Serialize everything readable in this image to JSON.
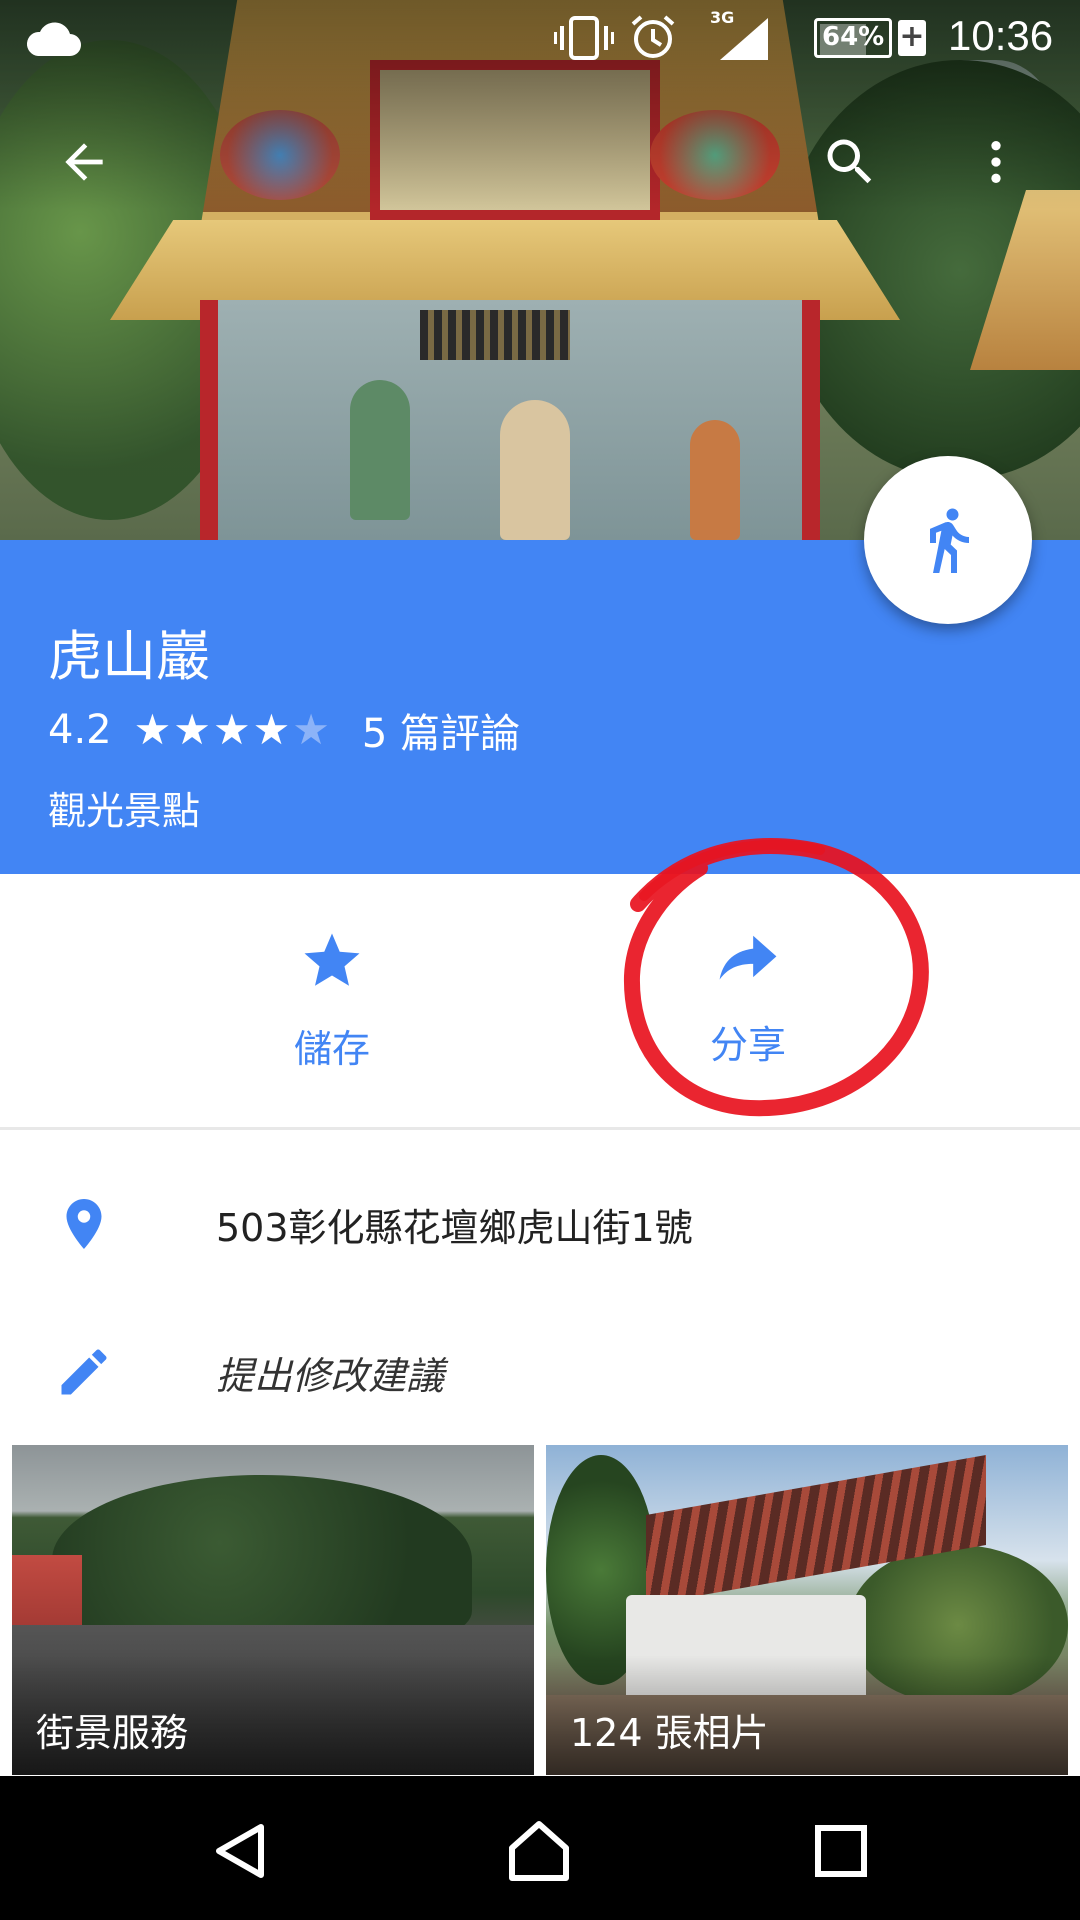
{
  "status_bar": {
    "network_type": "3G",
    "battery_percent": "64%",
    "battery_level": 0.64,
    "time": "10:36",
    "icons": [
      "cloud-icon",
      "vibrate-icon",
      "alarm-icon",
      "signal-icon",
      "battery-charging-icon"
    ]
  },
  "app_bar": {
    "icons": [
      "back-arrow-icon",
      "search-icon",
      "more-vert-icon"
    ]
  },
  "place": {
    "title": "虎山巖",
    "rating": "4.2",
    "rating_value": 4.2,
    "stars_filled": 4,
    "stars_total": 5,
    "reviews": "5 篇評論",
    "category": "觀光景點",
    "header_color": "#4285f4"
  },
  "fab": {
    "icon": "directions-walk-icon"
  },
  "actions": {
    "save_label": "儲存",
    "share_label": "分享",
    "icons": [
      "star-icon",
      "share-arrow-icon"
    ],
    "accent_color": "#4285f4",
    "highlight_color": "#e8121e"
  },
  "info": {
    "address": "503彰化縣花壇鄉虎山街1號",
    "suggest_edit": "提出修改建議",
    "icons": [
      "location-pin-icon",
      "edit-pencil-icon"
    ]
  },
  "tiles": {
    "street_view_label": "街景服務",
    "photos_label": "124 張相片"
  },
  "nav_bar": {
    "icons": [
      "nav-back-icon",
      "nav-home-icon",
      "nav-recents-icon"
    ]
  }
}
